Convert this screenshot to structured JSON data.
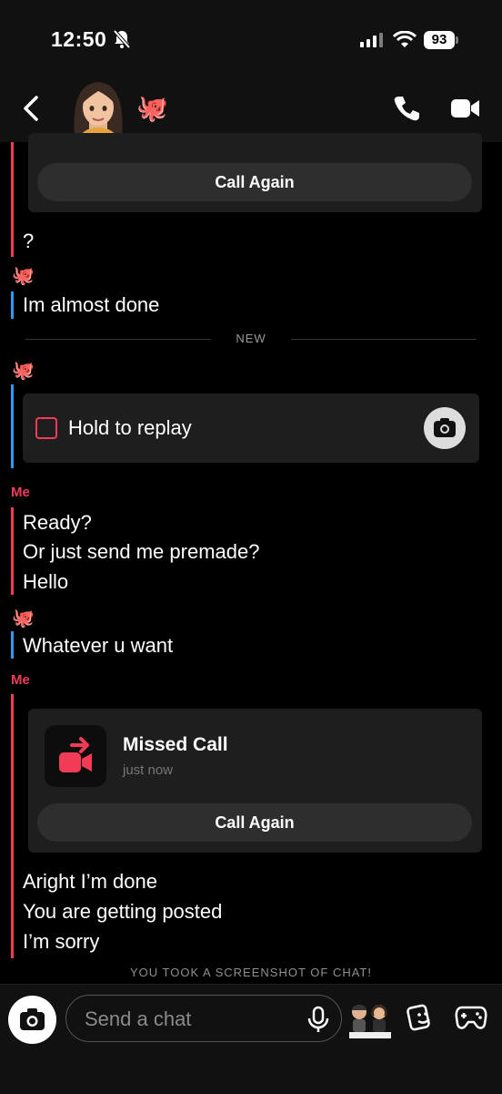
{
  "status_bar": {
    "time": "12:50",
    "battery": "93"
  },
  "header": {
    "contact_emoji": "🐙"
  },
  "chat": {
    "call_again_label": "Call Again",
    "q_message": "?",
    "friend_msg_1": "Im almost done",
    "new_divider": "NEW",
    "snap_label": "Hold to replay",
    "me_label": "Me",
    "me_msgs_1": [
      "Ready?",
      "Or just send me premade?",
      "Hello"
    ],
    "friend_msg_2": "Whatever u want",
    "missed_call": {
      "title": "Missed Call",
      "time": "just now",
      "button": "Call Again"
    },
    "me_msgs_2": [
      "Aright I’m done",
      "You are getting posted",
      "I’m sorry"
    ],
    "screenshot_note": "YOU TOOK A SCREENSHOT OF CHAT!"
  },
  "composer": {
    "placeholder": "Send a chat"
  },
  "colors": {
    "me": "#f23c57",
    "friend": "#2a9bf0",
    "background": "#000000"
  },
  "icons": [
    "back-icon",
    "phone-icon",
    "video-call-icon",
    "camera-icon",
    "mic-icon",
    "sticker-icon",
    "game-icon",
    "octopus-icon",
    "bell-slash-icon"
  ]
}
